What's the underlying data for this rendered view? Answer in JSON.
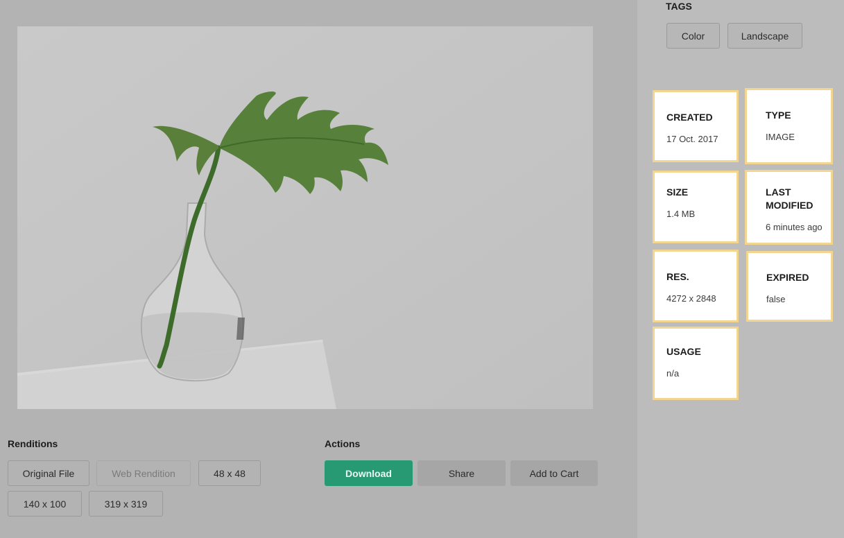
{
  "renditions": {
    "title": "Renditions",
    "items": [
      {
        "label": "Original File",
        "state": "enabled"
      },
      {
        "label": "Web Rendition",
        "state": "disabled"
      },
      {
        "label": "48 x 48",
        "state": "enabled"
      },
      {
        "label": "140 x 100",
        "state": "enabled"
      },
      {
        "label": "319 x 319",
        "state": "enabled"
      }
    ]
  },
  "actions": {
    "title": "Actions",
    "download": "Download",
    "share": "Share",
    "add_to_cart": "Add to Cart"
  },
  "tags": {
    "title": "TAGS",
    "items": [
      "Color",
      "Landscape"
    ]
  },
  "metadata": {
    "created": {
      "label": "CREATED",
      "value": "17 Oct. 2017"
    },
    "type": {
      "label": "TYPE",
      "value": "IMAGE"
    },
    "size": {
      "label": "SIZE",
      "value": "1.4 MB"
    },
    "last_modified": {
      "label": "LAST MODIFIED",
      "value": "6 minutes ago"
    },
    "resolution": {
      "label": "RES.",
      "value": "4272 x 2848"
    },
    "expired": {
      "label": "EXPIRED",
      "value": "false"
    },
    "usage": {
      "label": "USAGE",
      "value": "n/a"
    }
  },
  "colors": {
    "primary": "#279a73",
    "card_border": "#f2d58f"
  }
}
